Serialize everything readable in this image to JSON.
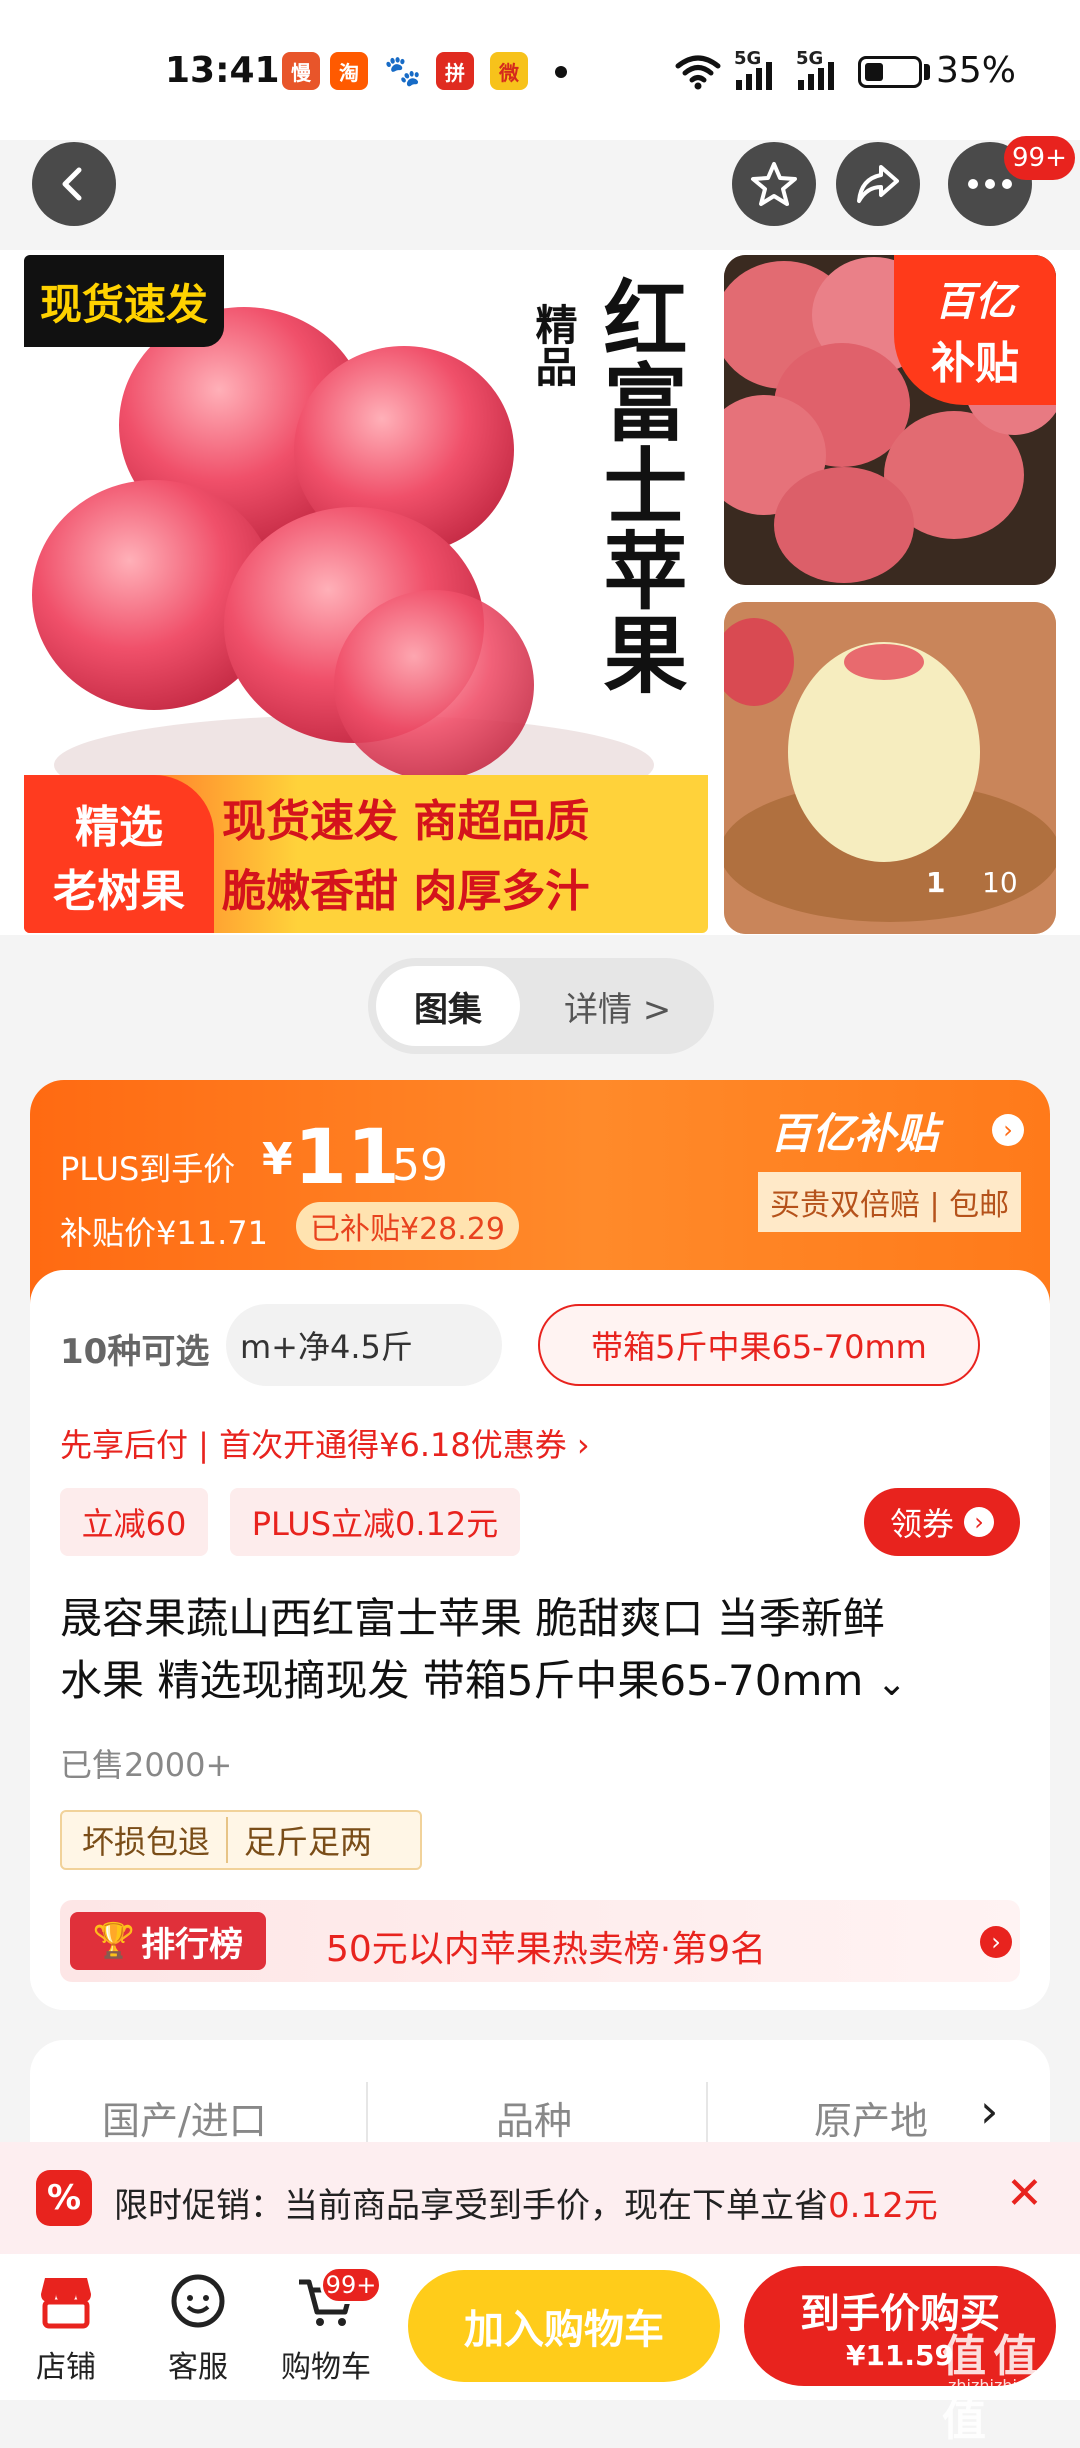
{
  "status": {
    "time": "13:41",
    "battery": "35%",
    "net1": "5G",
    "net2": "5G"
  },
  "nav": {
    "cart_badge": "99+"
  },
  "hero": {
    "corner_tag": "现货速发",
    "side_small": "精品",
    "side_big": "红富士苹果",
    "badge_line1": "精选",
    "badge_line2": "老树果",
    "banner_line1": "现货速发 商超品质",
    "banner_line2": "脆嫩香甜 肉厚多汁"
  },
  "thumbs": {
    "subsidy_l1": "百亿",
    "subsidy_l2": "补贴",
    "page_current": "1",
    "page_total": "10"
  },
  "toggle": {
    "active": "图集",
    "inactive": "详情 >"
  },
  "price": {
    "plus_label": "PLUS到手价",
    "currency": "¥",
    "int": "11",
    "dec": ".59",
    "sub_label": "补贴价¥11.71",
    "subsidized": "已补贴¥28.29",
    "brand": "百亿补贴",
    "guarantee": "买贵双倍赔 | 包邮"
  },
  "options": {
    "count": "10种可选",
    "chip1": "m+净4.5斤",
    "chip2": "带箱5斤中果65-70mm"
  },
  "pay_later": "先享后付 | 首次开通得¥6.18优惠券 ›",
  "discounts": {
    "tag1": "立减60",
    "tag2": "PLUS立减0.12元",
    "coupon": "领券"
  },
  "title": {
    "line1": "晟容果蔬山西红富士苹果 脆甜爽口 当季新鲜",
    "line2": "水果 精选现摘现发 带箱5斤中果65-70mm"
  },
  "sold": "已售2000+",
  "service": {
    "s1": "坏损包退",
    "s2": "足斤足两"
  },
  "rank": {
    "label": "排行榜",
    "text": "50元以内苹果热卖榜·第9名"
  },
  "specs": {
    "c1": "国产/进口",
    "c2": "品种",
    "c3": "原产地"
  },
  "promo": {
    "text": "限时促销：当前商品享受到手价，现在下单立省",
    "amount": "0.12元"
  },
  "bottom": {
    "shop": "店铺",
    "service": "客服",
    "cart": "购物车",
    "cart_badge": "99+",
    "add_cart": "加入购物车",
    "buy": "到手价购买",
    "buy_price": "¥11.59"
  },
  "watermark": "值 值 值",
  "watermark_url": "zhizhizhi.com",
  "colors": {
    "accent": "#e8231e",
    "orange": "#ff6a12",
    "yellow": "#ffcc1a"
  }
}
